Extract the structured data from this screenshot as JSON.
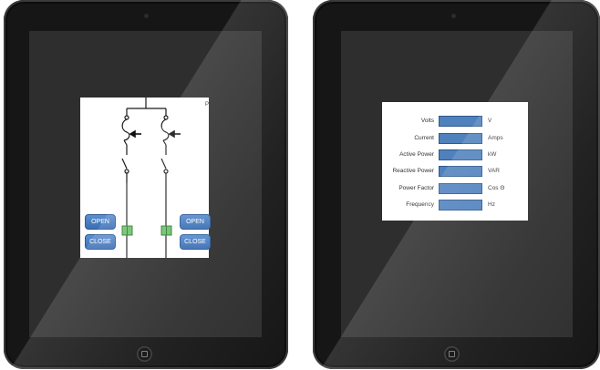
{
  "switchgear": {
    "left_feeder": {
      "open_label": "OPEN",
      "close_label": "CLOSE"
    },
    "right_feeder": {
      "open_label": "OPEN",
      "close_label": "CLOSE"
    },
    "corner_mark": "P"
  },
  "meter": {
    "rows": [
      {
        "label": "Volts",
        "unit": "V"
      },
      {
        "label": "Current",
        "unit": "Amps"
      },
      {
        "label": "Active Power",
        "unit": "kW"
      },
      {
        "label": "Reactive Power",
        "unit": "VAR"
      },
      {
        "label": "Power Factor",
        "unit": "Cos Θ"
      },
      {
        "label": "Frequency",
        "unit": "Hz"
      }
    ]
  },
  "colors": {
    "button_blue": "#3f72b7",
    "field_blue": "#4f81bd",
    "breaker_green": "#6cc16c",
    "tablet_bezel": "#161616",
    "screen": "#2e2e2e"
  }
}
